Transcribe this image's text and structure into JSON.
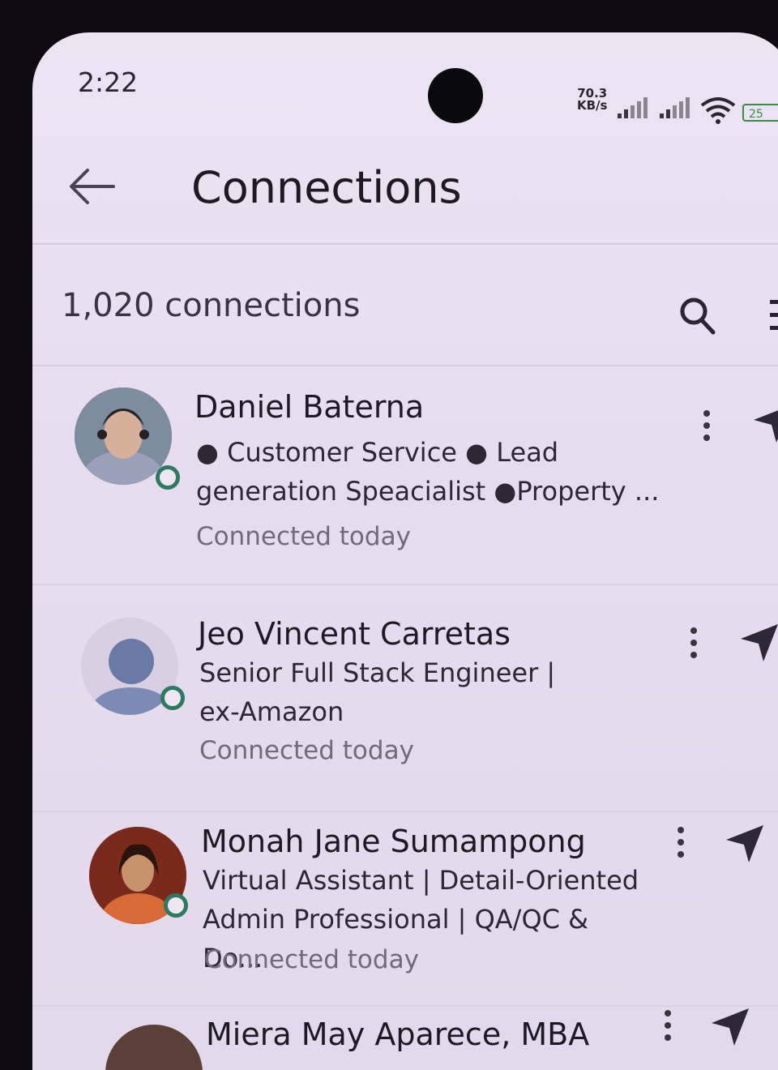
{
  "status_bar": {
    "time": "2:22",
    "net_speed_value": "70.3",
    "net_speed_unit": "KB/s",
    "battery": "25"
  },
  "header": {
    "title": "Connections"
  },
  "connections_count": "1,020 connections",
  "connections": [
    {
      "name": "Daniel Baterna",
      "headline": "● Customer Service ● Lead generation Speacialist ●Property ...",
      "status": "Connected today"
    },
    {
      "name": "Jeo Vincent Carretas",
      "headline": "Senior Full Stack Engineer | ex-Amazon",
      "status": "Connected today"
    },
    {
      "name": "Monah Jane Sumampong",
      "headline": "Virtual Assistant | Detail-Oriented Admin Professional | QA/QC & Do...",
      "status": "Connected today"
    },
    {
      "name": "Miera May Aparece, MBA"
    }
  ],
  "colors": {
    "background": "#e8def0",
    "online_dot": "#2d7a62",
    "text_primary": "#1e1a24",
    "text_secondary": "#716a78"
  }
}
